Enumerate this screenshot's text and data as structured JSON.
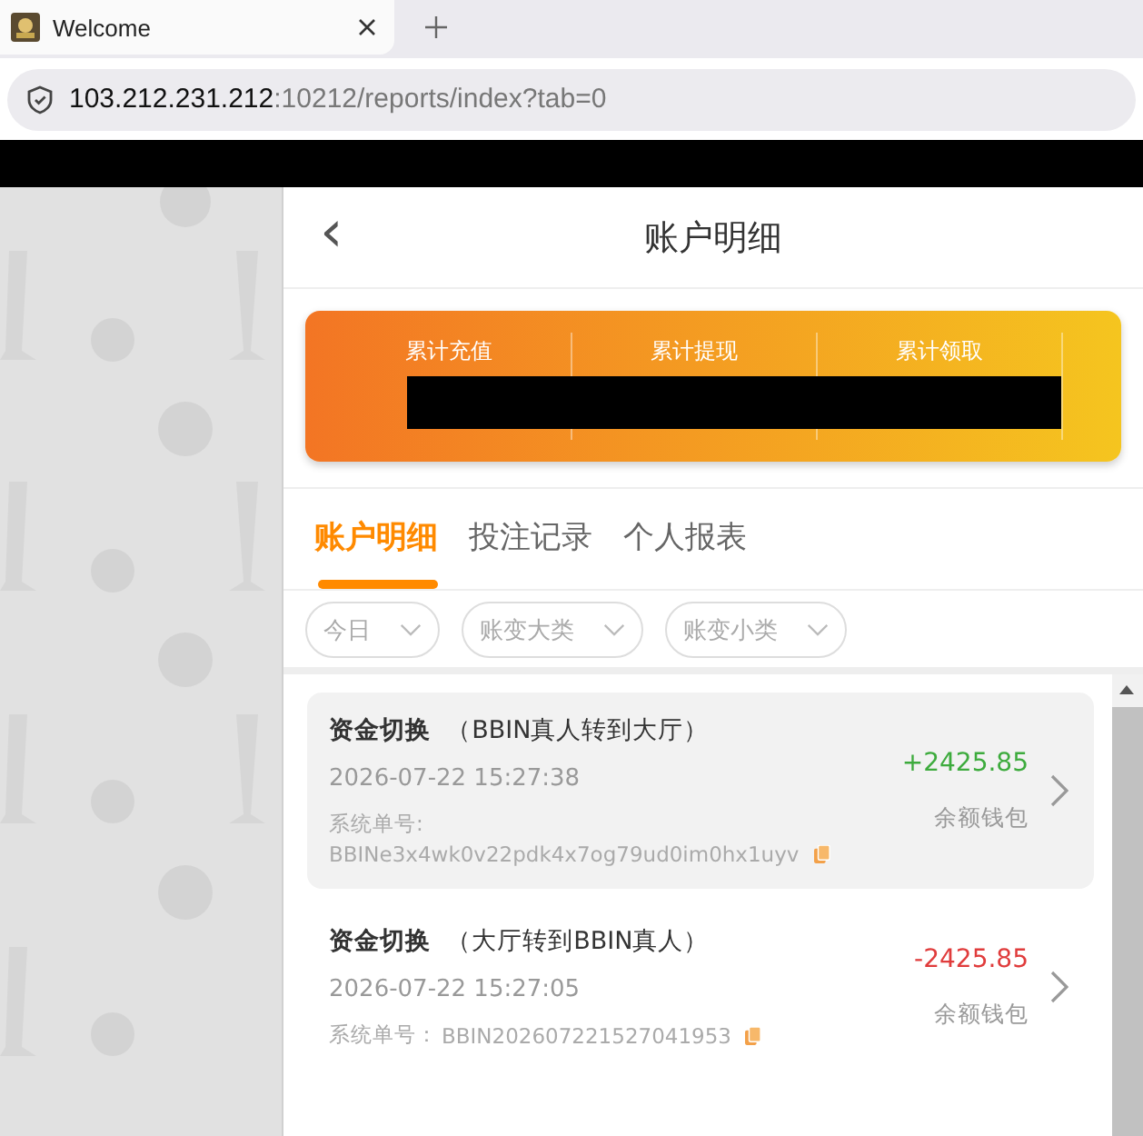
{
  "browser": {
    "tab_title": "Welcome",
    "url_host": "103.212.231.212",
    "url_rest": ":10212/reports/index?tab=0"
  },
  "header": {
    "back": "‹",
    "title": "账户明细"
  },
  "summary": [
    {
      "label": "累计充值"
    },
    {
      "label": "累计提现"
    },
    {
      "label": "累计领取"
    }
  ],
  "tabs": [
    {
      "label": "账户明细",
      "selected": true
    },
    {
      "label": "投注记录",
      "selected": false
    },
    {
      "label": "个人报表",
      "selected": false
    }
  ],
  "filters": [
    {
      "label": "今日"
    },
    {
      "label": "账变大类"
    },
    {
      "label": "账变小类"
    }
  ],
  "records": [
    {
      "title": "资金切换",
      "detail": "（BBIN真人转到大厅）",
      "time": "2026-07-22 15:27:38",
      "order_label": "系统单号:",
      "order_no": "BBINe3x4wk0v22pdk4x7og79ud0im0hx1uyv",
      "amount": "+2425.85",
      "kind": "credit",
      "wallet": "余额钱包",
      "selected": true
    },
    {
      "title": "资金切换",
      "detail": "（大厅转到BBIN真人）",
      "time": "2026-07-22 15:27:05",
      "order_label": "系统单号：",
      "order_no": "BBIN202607221527041953",
      "amount": "-2425.85",
      "kind": "debit",
      "wallet": "余额钱包",
      "selected": false
    }
  ]
}
